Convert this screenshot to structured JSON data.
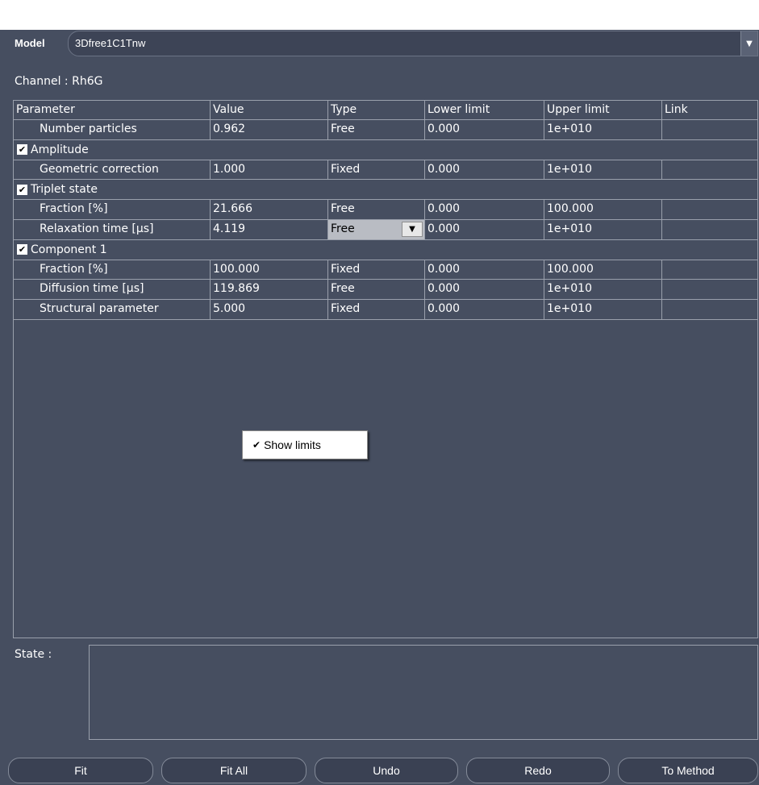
{
  "model": {
    "label": "Model",
    "value": "3Dfree1C1Tnw",
    "arrow_icon": "chevron-down"
  },
  "channel": "Channel : Rh6G",
  "table": {
    "headers": [
      "Parameter",
      "Value",
      "Type",
      "Lower limit",
      "Upper limit",
      "Link"
    ],
    "rows": [
      {
        "param": "Number particles",
        "value": "0.962",
        "type": "Free",
        "lower": "0.000",
        "upper": "1e+010",
        "link": ""
      },
      {
        "group": "Amplitude"
      },
      {
        "param": "Geometric correction",
        "value": "1.000",
        "type": "Fixed",
        "lower": "0.000",
        "upper": "1e+010",
        "link": ""
      },
      {
        "group": "Triplet state"
      },
      {
        "param": "Fraction [%]",
        "value": "21.666",
        "type": "Free",
        "lower": "0.000",
        "upper": "100.000",
        "link": ""
      },
      {
        "param": "Relaxation time [µs]",
        "value": "4.119",
        "type": "Free",
        "lower": "0.000",
        "upper": "1e+010",
        "link": ""
      },
      {
        "group": "Component 1"
      },
      {
        "param": "Fraction [%]",
        "value": "100.000",
        "type": "Fixed",
        "lower": "0.000",
        "upper": "100.000",
        "link": ""
      },
      {
        "param": "Diffusion time [µs]",
        "value": "119.869",
        "type": "Free",
        "lower": "0.000",
        "upper": "1e+010",
        "link": ""
      },
      {
        "param": "Structural parameter",
        "value": "5.000",
        "type": "Fixed",
        "lower": "0.000",
        "upper": "1e+010",
        "link": ""
      }
    ]
  },
  "context_menu": {
    "item": "Show limits",
    "checked": true
  },
  "state": {
    "label": "State :",
    "value": ""
  },
  "buttons": {
    "fit": "Fit",
    "fit_all": "Fit All",
    "undo": "Undo",
    "redo": "Redo",
    "to_method": "To Method"
  }
}
